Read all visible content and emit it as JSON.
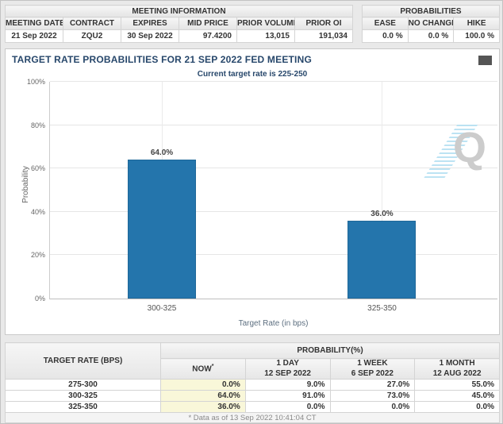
{
  "colors": {
    "accent_navy": "#27476b",
    "bar_blue": "#2475ac",
    "now_highlight": "#f9f7d9"
  },
  "meeting_info": {
    "title": "MEETING INFORMATION",
    "columns": [
      "MEETING DATE",
      "CONTRACT",
      "EXPIRES",
      "MID PRICE",
      "PRIOR VOLUME",
      "PRIOR OI"
    ],
    "values": [
      "21 Sep 2022",
      "ZQU2",
      "30 Sep 2022",
      "97.4200",
      "13,015",
      "191,034"
    ]
  },
  "probabilities_panel": {
    "title": "PROBABILITIES",
    "columns": [
      "EASE",
      "NO CHANGE",
      "HIKE"
    ],
    "values": [
      "0.0 %",
      "0.0 %",
      "100.0 %"
    ]
  },
  "chart_data": {
    "type": "bar",
    "title": "TARGET RATE PROBABILITIES FOR 21 SEP 2022 FED MEETING",
    "subtitle": "Current target rate is 225-250",
    "categories": [
      "300-325",
      "325-350"
    ],
    "values": [
      64.0,
      36.0
    ],
    "value_labels": [
      "64.0%",
      "36.0%"
    ],
    "xlabel": "Target Rate (in bps)",
    "ylabel": "Probability",
    "ylim": [
      0,
      100
    ],
    "yticks": [
      "0%",
      "20%",
      "40%",
      "60%",
      "80%",
      "100%"
    ],
    "grid": "on",
    "legend": "none",
    "bar_color": "#2475ac",
    "watermark": "Q"
  },
  "history_table": {
    "corner_header": "TARGET RATE (BPS)",
    "group_header": "PROBABILITY(%)",
    "columns": [
      {
        "label": "NOW",
        "sup": "*",
        "date": ""
      },
      {
        "label": "1 DAY",
        "date": "12 SEP 2022"
      },
      {
        "label": "1 WEEK",
        "date": "6 SEP 2022"
      },
      {
        "label": "1 MONTH",
        "date": "12 AUG 2022"
      }
    ],
    "rows": [
      {
        "rate": "275-300",
        "now": "0.0%",
        "day": "9.0%",
        "week": "27.0%",
        "month": "55.0%"
      },
      {
        "rate": "300-325",
        "now": "64.0%",
        "day": "91.0%",
        "week": "73.0%",
        "month": "45.0%"
      },
      {
        "rate": "325-350",
        "now": "36.0%",
        "day": "0.0%",
        "week": "0.0%",
        "month": "0.0%"
      }
    ],
    "footnote": "* Data as of 13 Sep 2022 10:41:04 CT"
  }
}
